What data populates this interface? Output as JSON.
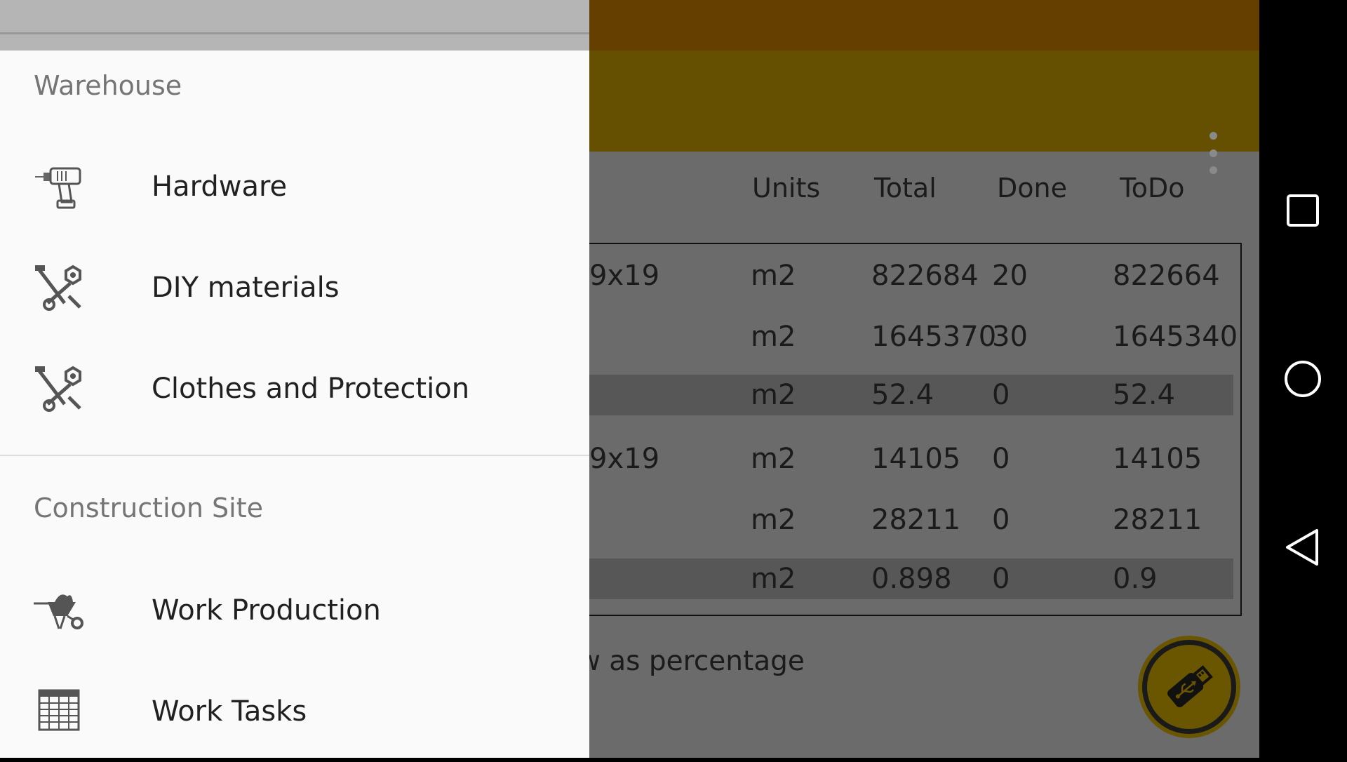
{
  "table": {
    "headers": {
      "units": "Units",
      "total": "Total",
      "done": "Done",
      "todo": "ToDo"
    },
    "rows": [
      {
        "name": "9x19",
        "units": "m2",
        "total": "822684",
        "done": "20",
        "todo": "822664",
        "highlighted": false
      },
      {
        "name": "",
        "units": "m2",
        "total": "1645370",
        "done": "30",
        "todo": "1645340",
        "highlighted": false
      },
      {
        "name": "",
        "units": "m2",
        "total": "52.4",
        "done": "0",
        "todo": "52.4",
        "highlighted": true
      },
      {
        "name": "9x19",
        "units": "m2",
        "total": "14105",
        "done": "0",
        "todo": "14105",
        "highlighted": false
      },
      {
        "name": "",
        "units": "m2",
        "total": "28211",
        "done": "0",
        "todo": "28211",
        "highlighted": false
      },
      {
        "name": "",
        "units": "m2",
        "total": "0.898",
        "done": "0",
        "todo": "0.9",
        "highlighted": true
      }
    ]
  },
  "switch_label": "ew as percentage",
  "fab": {
    "icon": "usb-drive-icon"
  },
  "toolbar": {
    "overflow_icon": "more-vert-icon"
  },
  "drawer": {
    "sections": [
      {
        "title": "Warehouse",
        "items": [
          {
            "label": "Hardware",
            "icon": "drill-icon"
          },
          {
            "label": "DIY materials",
            "icon": "tools-icon"
          },
          {
            "label": "Clothes and Protection",
            "icon": "tools-icon"
          }
        ]
      },
      {
        "title": "Construction Site",
        "items": [
          {
            "label": "Work Production",
            "icon": "wheelbarrow-icon"
          },
          {
            "label": "Work Tasks",
            "icon": "spreadsheet-icon"
          }
        ]
      }
    ]
  },
  "system_nav": {
    "recents": "square-icon",
    "home": "circle-icon",
    "back": "triangle-back-icon"
  },
  "colors": {
    "statusbar": "#653f00",
    "appbar": "#654f00",
    "drawer": "#fafafa",
    "accent": "#6a5500"
  }
}
